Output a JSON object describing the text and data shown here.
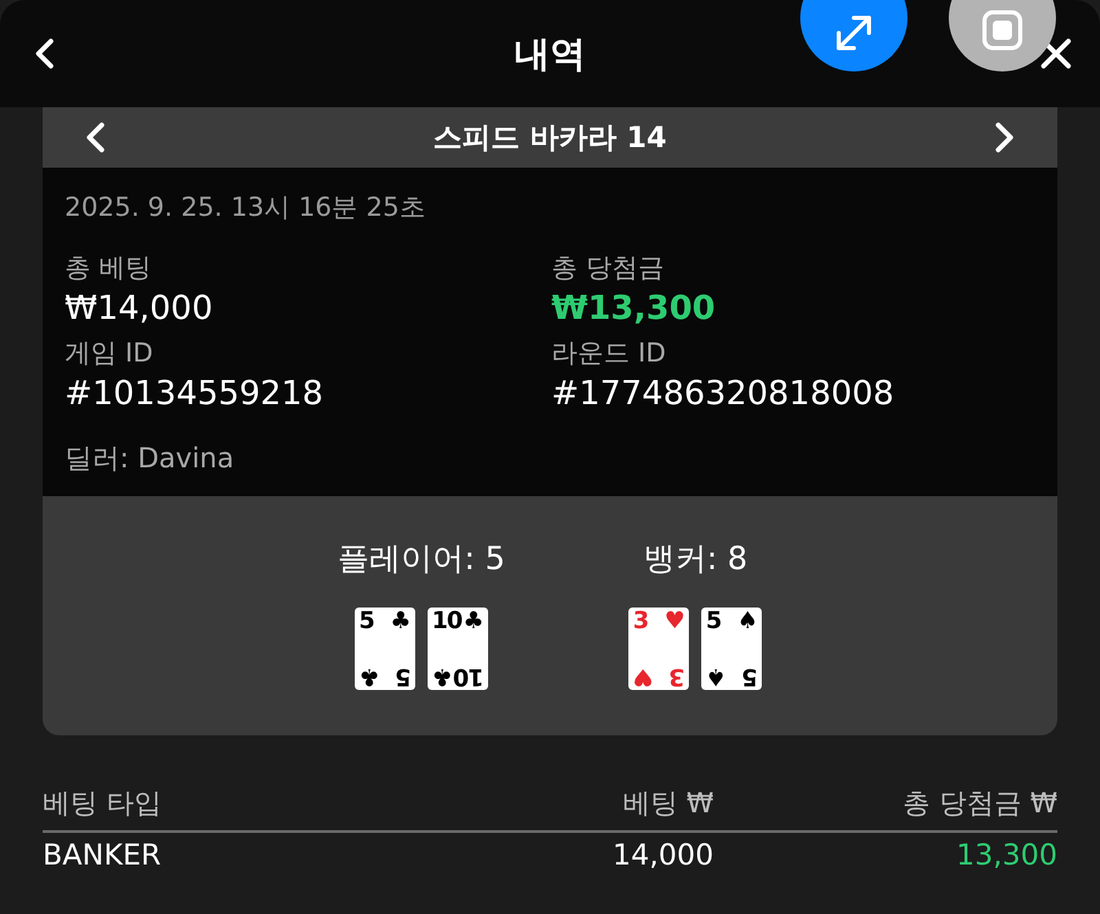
{
  "header": {
    "title": "내역"
  },
  "game": {
    "title": "스피드 바카라 14",
    "datetime": "2025. 9. 25. 13시 16분 25초",
    "fields": [
      {
        "label": "총 베팅",
        "value": "₩14,000",
        "kind": "plain"
      },
      {
        "label": "총 당첨금",
        "value": "₩13,300",
        "kind": "win"
      },
      {
        "label": "게임 ID",
        "value": "#10134559218",
        "kind": "plain"
      },
      {
        "label": "라운드 ID",
        "value": "#177486320818008",
        "kind": "plain"
      }
    ],
    "dealer": "딜러: Davina"
  },
  "hands": [
    {
      "label": "플레이어: 5",
      "cards": [
        {
          "color": "#000000",
          "top": {
            "rank": "5",
            "suit": "♣"
          },
          "bottom": {
            "rank": "5",
            "suit": "♣"
          }
        },
        {
          "color": "#000000",
          "top": {
            "rank": "10",
            "suit": "♣"
          },
          "bottom": {
            "rank": "10",
            "suit": "♣"
          }
        }
      ]
    },
    {
      "label": "뱅커: 8",
      "cards": [
        {
          "color": "#e8262d",
          "top": {
            "rank": "3",
            "suit": "♥"
          },
          "bottom": {
            "rank": "3",
            "suit": "♥"
          }
        },
        {
          "color": "#000000",
          "top": {
            "rank": "5",
            "suit": "♠"
          },
          "bottom": {
            "rank": "5",
            "suit": "♠"
          }
        }
      ]
    }
  ],
  "table": {
    "columns": [
      "베팅 타입",
      "베팅 ₩",
      "총 당첨금 ₩"
    ],
    "rows": [
      {
        "cells": [
          "BANKER",
          "14,000",
          "13,300"
        ],
        "win": true
      }
    ]
  }
}
